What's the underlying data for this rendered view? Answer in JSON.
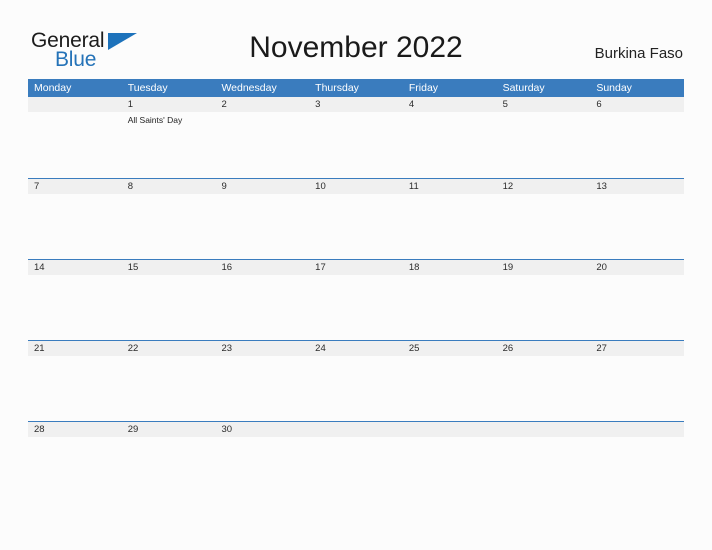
{
  "brand": {
    "name_part1": "General",
    "name_part2": "Blue",
    "flag_icon": "triangle-flag-icon",
    "accent_color": "#2573b8"
  },
  "header": {
    "title": "November 2022",
    "country": "Burkina Faso"
  },
  "theme": {
    "header_blue": "#3a7cbe",
    "band_gray": "#f0f0f0",
    "page_background": "#fcfcfc",
    "text_dark": "#1a1a1a"
  },
  "calendar": {
    "month": "November",
    "year": "2022",
    "weekdays": [
      "Monday",
      "Tuesday",
      "Wednesday",
      "Thursday",
      "Friday",
      "Saturday",
      "Sunday"
    ],
    "weeks": [
      {
        "days": [
          {
            "num": "",
            "event": ""
          },
          {
            "num": "1",
            "event": "All Saints' Day"
          },
          {
            "num": "2",
            "event": ""
          },
          {
            "num": "3",
            "event": ""
          },
          {
            "num": "4",
            "event": ""
          },
          {
            "num": "5",
            "event": ""
          },
          {
            "num": "6",
            "event": ""
          }
        ]
      },
      {
        "days": [
          {
            "num": "7",
            "event": ""
          },
          {
            "num": "8",
            "event": ""
          },
          {
            "num": "9",
            "event": ""
          },
          {
            "num": "10",
            "event": ""
          },
          {
            "num": "11",
            "event": ""
          },
          {
            "num": "12",
            "event": ""
          },
          {
            "num": "13",
            "event": ""
          }
        ]
      },
      {
        "days": [
          {
            "num": "14",
            "event": ""
          },
          {
            "num": "15",
            "event": ""
          },
          {
            "num": "16",
            "event": ""
          },
          {
            "num": "17",
            "event": ""
          },
          {
            "num": "18",
            "event": ""
          },
          {
            "num": "19",
            "event": ""
          },
          {
            "num": "20",
            "event": ""
          }
        ]
      },
      {
        "days": [
          {
            "num": "21",
            "event": ""
          },
          {
            "num": "22",
            "event": ""
          },
          {
            "num": "23",
            "event": ""
          },
          {
            "num": "24",
            "event": ""
          },
          {
            "num": "25",
            "event": ""
          },
          {
            "num": "26",
            "event": ""
          },
          {
            "num": "27",
            "event": ""
          }
        ]
      },
      {
        "days": [
          {
            "num": "28",
            "event": ""
          },
          {
            "num": "29",
            "event": ""
          },
          {
            "num": "30",
            "event": ""
          },
          {
            "num": "",
            "event": ""
          },
          {
            "num": "",
            "event": ""
          },
          {
            "num": "",
            "event": ""
          },
          {
            "num": "",
            "event": ""
          }
        ]
      }
    ]
  }
}
